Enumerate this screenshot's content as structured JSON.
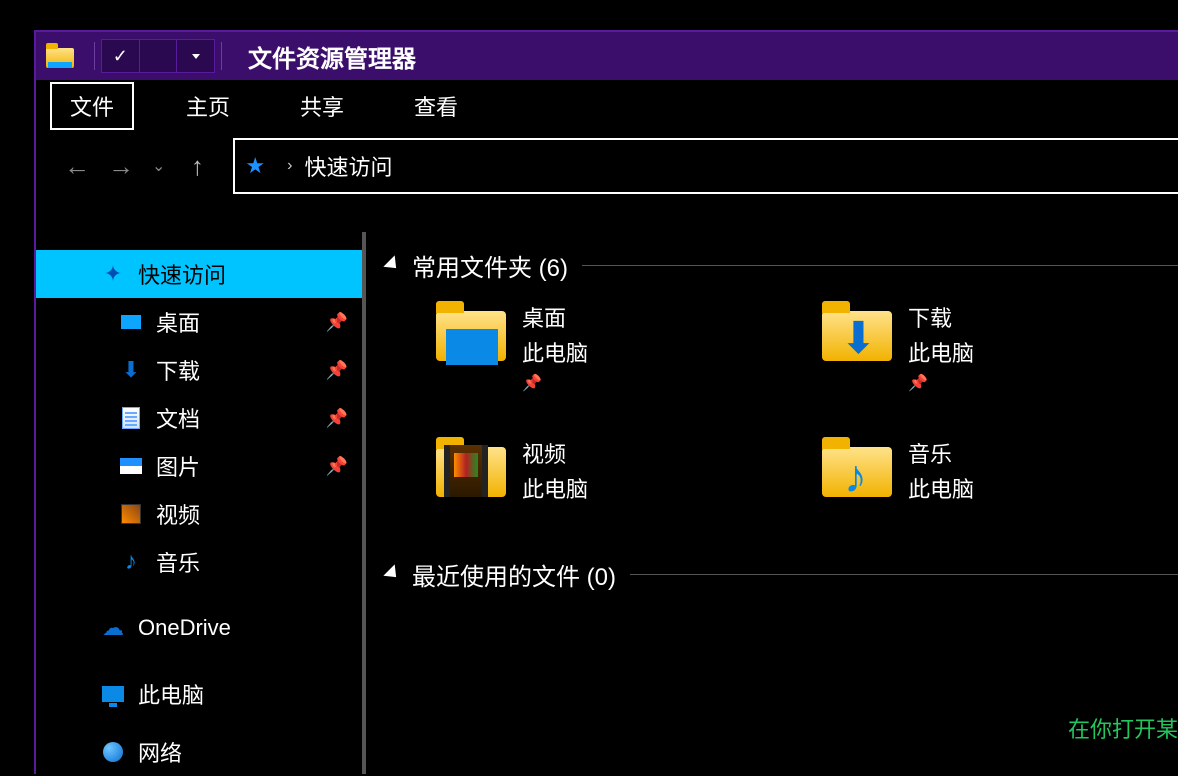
{
  "title": "文件资源管理器",
  "tabs": {
    "file": "文件",
    "home": "主页",
    "share": "共享",
    "view": "查看"
  },
  "breadcrumb": {
    "root": "快速访问",
    "sep": "›"
  },
  "sidebar": {
    "quick_access": "快速访问",
    "items": [
      {
        "label": "桌面",
        "pinned": true
      },
      {
        "label": "下载",
        "pinned": true
      },
      {
        "label": "文档",
        "pinned": true
      },
      {
        "label": "图片",
        "pinned": true
      },
      {
        "label": "视频",
        "pinned": false
      },
      {
        "label": "音乐",
        "pinned": false
      }
    ],
    "onedrive": "OneDrive",
    "this_pc": "此电脑",
    "network": "网络"
  },
  "groups": {
    "frequent": {
      "title": "常用文件夹 (6)"
    },
    "recent": {
      "title": "最近使用的文件 (0)",
      "hint": "在你打开某"
    }
  },
  "folders": [
    {
      "name": "桌面",
      "sub": "此电脑",
      "pinned": true,
      "overlay": "desktop"
    },
    {
      "name": "下载",
      "sub": "此电脑",
      "pinned": true,
      "overlay": "download"
    },
    {
      "name": "视频",
      "sub": "此电脑",
      "pinned": false,
      "overlay": "video"
    },
    {
      "name": "音乐",
      "sub": "此电脑",
      "pinned": false,
      "overlay": "music"
    }
  ]
}
